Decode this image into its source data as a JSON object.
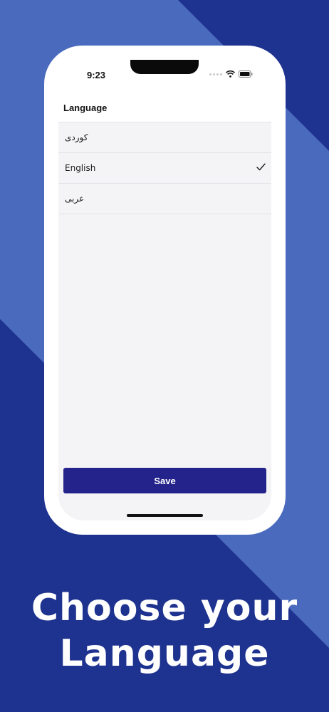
{
  "status_bar": {
    "time": "9:23"
  },
  "nav": {
    "title": "Language"
  },
  "languages": [
    {
      "label": "کوردی",
      "selected": false
    },
    {
      "label": "English",
      "selected": true
    },
    {
      "label": "عربی",
      "selected": false
    }
  ],
  "save_label": "Save",
  "headline": {
    "line1": "Choose your",
    "line2": "Language"
  },
  "colors": {
    "background_dark": "#1e338f",
    "background_light": "#4a6bbd",
    "save_button": "#24238c"
  },
  "icons": {
    "check": "check-icon",
    "wifi": "wifi-icon",
    "battery": "battery-icon"
  }
}
